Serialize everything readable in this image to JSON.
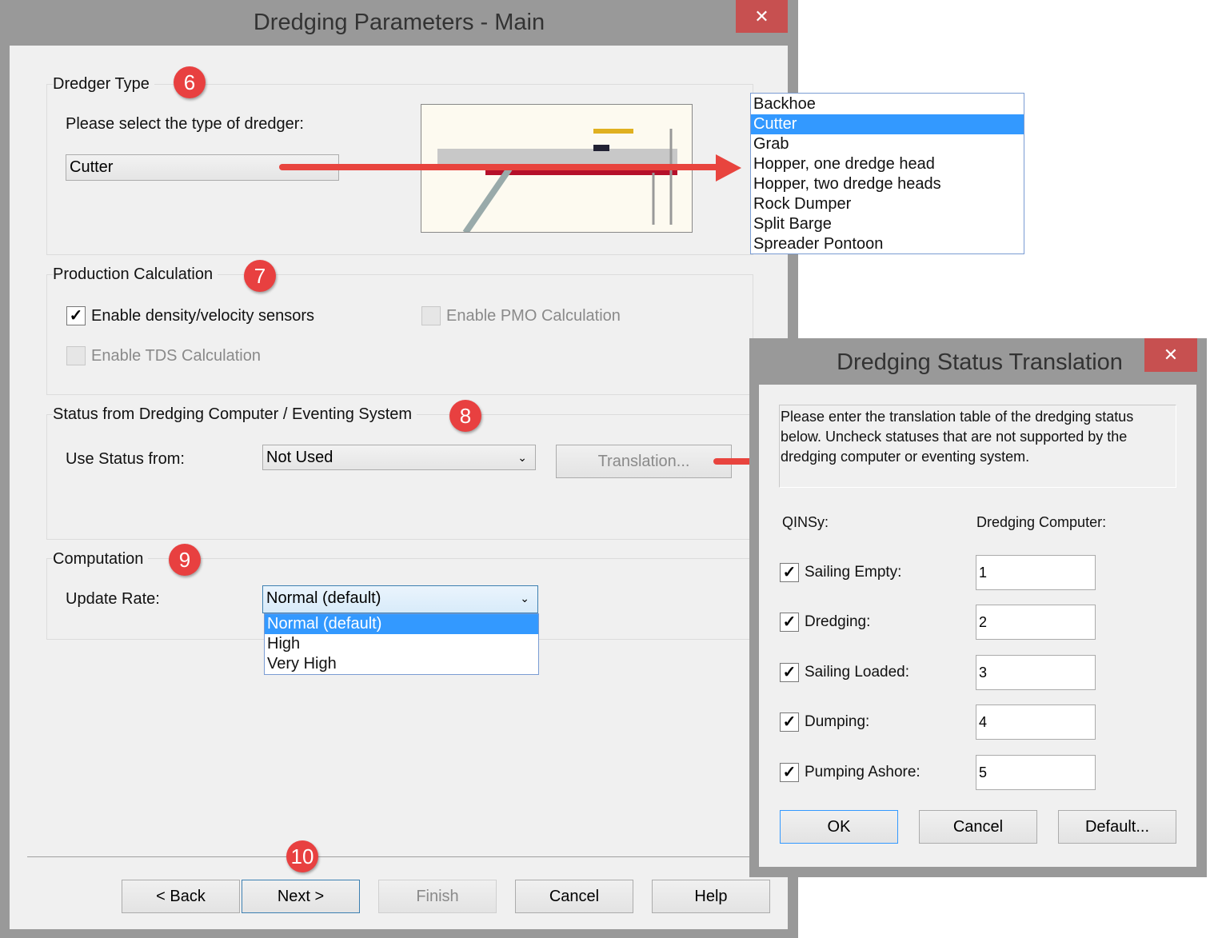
{
  "main_window": {
    "title": "Dredging Parameters - Main",
    "close_label": "✕",
    "dredger_type": {
      "group_label": "Dredger Type",
      "badge": "6",
      "prompt": "Please select the type of dredger:",
      "selected": "Cutter",
      "options": [
        "Backhoe",
        "Cutter",
        "Grab",
        "Hopper, one dredge head",
        "Hopper, two dredge heads",
        "Rock Dumper",
        "Split Barge",
        "Spreader Pontoon"
      ]
    },
    "production": {
      "group_label": "Production Calculation",
      "badge": "7",
      "density_sensors": "Enable density/velocity sensors",
      "pmo": "Enable PMO Calculation",
      "tds": "Enable TDS Calculation"
    },
    "status": {
      "group_label": "Status from Dredging Computer / Eventing System",
      "badge": "8",
      "use_status_label": "Use Status from:",
      "use_status_value": "Not Used",
      "translation_button": "Translation..."
    },
    "computation": {
      "group_label": "Computation",
      "badge": "9",
      "update_rate_label": "Update Rate:",
      "update_rate_value": "Normal (default)",
      "options": [
        "Normal (default)",
        "High",
        "Very High"
      ]
    },
    "footer": {
      "badge": "10",
      "back": "< Back",
      "next": "Next >",
      "finish": "Finish",
      "cancel": "Cancel",
      "help": "Help"
    }
  },
  "translation_dialog": {
    "title": "Dredging Status Translation",
    "close_label": "✕",
    "description": "Please enter the translation table of the dredging status below. Uncheck statuses that are not supported by the dredging computer or eventing system.",
    "col_qinsy": "QINSy:",
    "col_computer": "Dredging Computer:",
    "rows": [
      {
        "label": "Sailing Empty:",
        "value": "1"
      },
      {
        "label": "Dredging:",
        "value": "2"
      },
      {
        "label": "Sailing Loaded:",
        "value": "3"
      },
      {
        "label": "Dumping:",
        "value": "4"
      },
      {
        "label": "Pumping Ashore:",
        "value": "5"
      }
    ],
    "ok": "OK",
    "cancel": "Cancel",
    "default": "Default..."
  }
}
